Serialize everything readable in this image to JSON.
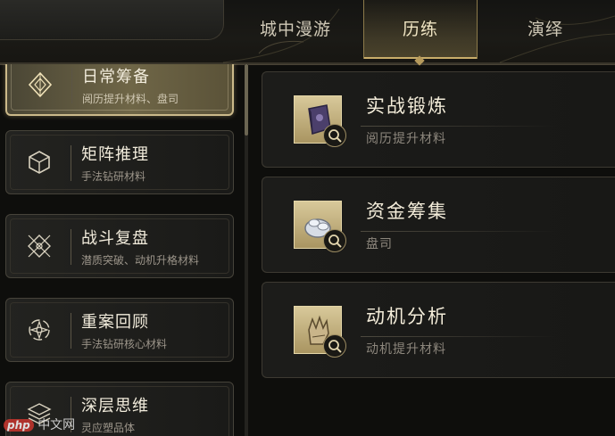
{
  "tabs": [
    {
      "label": "城中漫游",
      "active": false
    },
    {
      "label": "历练",
      "active": true
    },
    {
      "label": "演绎",
      "active": false
    }
  ],
  "categories": [
    {
      "title": "日常筹备",
      "subtitle": "阅历提升材料、盘司",
      "icon": "diamond-sigil-icon",
      "active": true
    },
    {
      "title": "矩阵推理",
      "subtitle": "手法钻研材料",
      "icon": "cube-sigil-icon",
      "active": false
    },
    {
      "title": "战斗复盘",
      "subtitle": "潜质突破、动机升格材料",
      "icon": "lattice-sigil-icon",
      "active": false
    },
    {
      "title": "重案回顾",
      "subtitle": "手法钻研核心材料",
      "icon": "spiral-star-icon",
      "active": false
    },
    {
      "title": "深层思维",
      "subtitle": "灵应塑品体",
      "icon": "stacked-layers-icon",
      "active": false
    }
  ],
  "tasks": [
    {
      "title": "实战锻炼",
      "subtitle": "阅历提升材料",
      "icon": "book-item-icon"
    },
    {
      "title": "资金筹集",
      "subtitle": "盘司",
      "icon": "coin-pile-item-icon"
    },
    {
      "title": "动机分析",
      "subtitle": "动机提升材料",
      "icon": "glove-item-icon"
    }
  ],
  "watermark": {
    "badge": "php",
    "text": "中文网"
  },
  "colors": {
    "accent_gold": "#c9ad6a",
    "active_card": "#6f6647",
    "background": "#0e0e0c"
  }
}
